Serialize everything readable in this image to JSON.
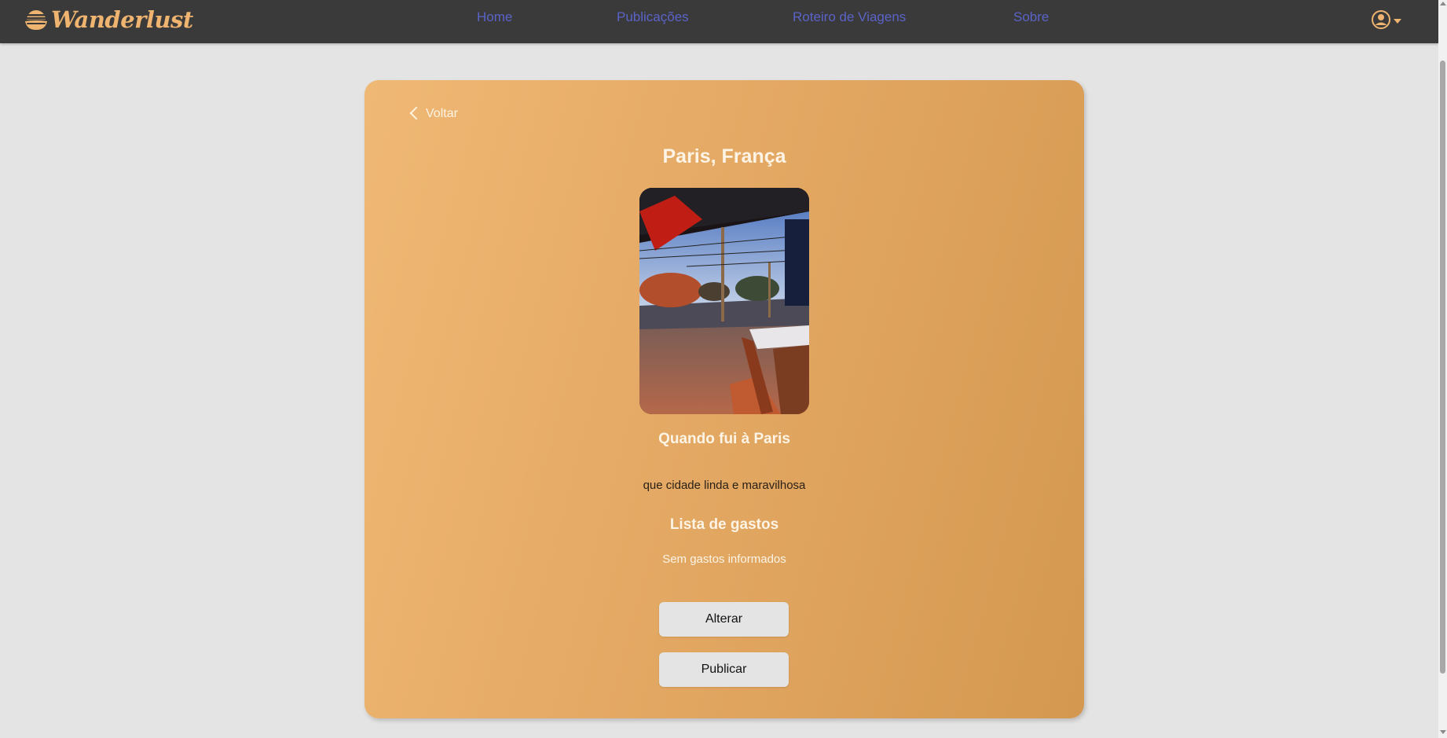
{
  "navbar": {
    "brand": "Wanderlust",
    "links": [
      "Home",
      "Publicações",
      "Roteiro de Viagens",
      "Sobre"
    ],
    "link_color": "#5a63c8",
    "brand_color": "#efb46f",
    "user_icon": "user-circle-icon"
  },
  "card": {
    "back_label": "Voltar",
    "title": "Paris, França",
    "photo_icon": "street-cafe-photo",
    "subtitle": "Quando fui à Paris",
    "description": "que cidade linda e maravilhosa",
    "expenses_title": "Lista de gastos",
    "expenses_empty": "Sem gastos informados",
    "buttons": {
      "edit": "Alterar",
      "publish": "Publicar"
    }
  }
}
